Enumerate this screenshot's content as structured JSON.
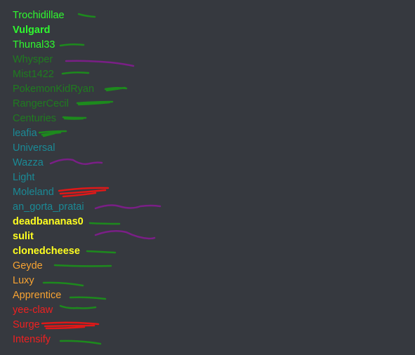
{
  "members": [
    {
      "name": "Trochidillae",
      "color": "#2ff92f",
      "bold": false,
      "mark": "green"
    },
    {
      "name": "Vulgard",
      "color": "#2ff92f",
      "bold": true,
      "mark": null
    },
    {
      "name": "Thunal33",
      "color": "#2ff92f",
      "bold": false,
      "mark": "green"
    },
    {
      "name": "Whysper",
      "color": "#1f7c1f",
      "bold": false,
      "mark": "purple"
    },
    {
      "name": "Mist1422",
      "color": "#1f7c1f",
      "bold": false,
      "mark": "green"
    },
    {
      "name": "PokemonKidRyan",
      "color": "#1f7c1f",
      "bold": false,
      "mark": "green"
    },
    {
      "name": "RangerCecil",
      "color": "#1f7c1f",
      "bold": false,
      "mark": "green"
    },
    {
      "name": "Centuries",
      "color": "#1f7c1f",
      "bold": false,
      "mark": "green"
    },
    {
      "name": "leafia",
      "color": "#1a8a96",
      "bold": false,
      "mark": "green"
    },
    {
      "name": "Universal",
      "color": "#1a8a96",
      "bold": false,
      "mark": null
    },
    {
      "name": "Wazza",
      "color": "#1a8a96",
      "bold": false,
      "mark": "purple"
    },
    {
      "name": "Light",
      "color": "#1a8a96",
      "bold": false,
      "mark": null
    },
    {
      "name": "Moleland",
      "color": "#1a8a96",
      "bold": false,
      "mark": "red"
    },
    {
      "name": "an_gorta_pratai",
      "color": "#1a8a96",
      "bold": false,
      "mark": "purple"
    },
    {
      "name": "deadbananas0",
      "color": "#ffff20",
      "bold": true,
      "mark": "green"
    },
    {
      "name": "sulit",
      "color": "#ffff20",
      "bold": true,
      "mark": "purple"
    },
    {
      "name": "clonedcheese",
      "color": "#ffff20",
      "bold": true,
      "mark": "green"
    },
    {
      "name": "Geyde",
      "color": "#f7a332",
      "bold": false,
      "mark": "green"
    },
    {
      "name": "Luxy",
      "color": "#f7a332",
      "bold": false,
      "mark": "green"
    },
    {
      "name": "Apprentice",
      "color": "#f7a332",
      "bold": false,
      "mark": "green"
    },
    {
      "name": "yee-claw",
      "color": "#f02020",
      "bold": false,
      "mark": "green"
    },
    {
      "name": "Surge",
      "color": "#f02020",
      "bold": false,
      "mark": "red"
    },
    {
      "name": "Intensify",
      "color": "#f02020",
      "bold": false,
      "mark": "green"
    }
  ],
  "mark_colors": {
    "green": "#1d8a1d",
    "purple": "#7a1f86",
    "red": "#e01818"
  }
}
